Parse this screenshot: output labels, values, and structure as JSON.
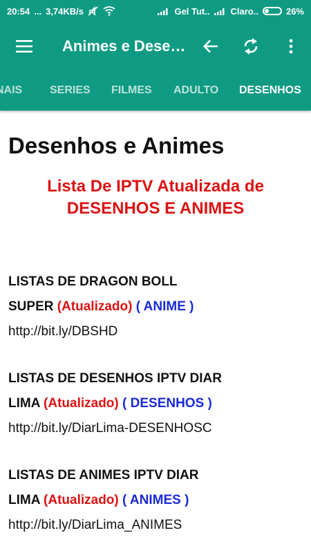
{
  "status_bar": {
    "time": "20:54",
    "dots": "...",
    "speed": "3,74KB/s",
    "carrier1": "Gel Tut..",
    "carrier2": "Claro..",
    "battery": "26%",
    "battery_level": 26
  },
  "toolbar": {
    "title": "Animes e Desenhos",
    "menu_icon": "hamburger-icon",
    "back_icon": "arrow-left-icon",
    "refresh_icon": "refresh-icon",
    "more_icon": "more-vert-icon"
  },
  "tabs": [
    {
      "label": "NAIS",
      "active": false
    },
    {
      "label": "SERIES",
      "active": false
    },
    {
      "label": "FILMES",
      "active": false
    },
    {
      "label": "ADULTO",
      "active": false
    },
    {
      "label": "DESENHOS",
      "active": true
    }
  ],
  "page": {
    "heading": "Desenhos e Animes",
    "subtitle_line1": "Lista De IPTV Atualizada de",
    "subtitle_line2": "DESENHOS E ANIMES"
  },
  "entries": [
    {
      "line1": "LISTAS DE DRAGON BOLL",
      "line2_prefix": "SUPER ",
      "status": "(Atualizado)",
      "tag_open": " ( ",
      "tag": "ANIME",
      "tag_close": " )",
      "url": "http://bit.ly/DBSHD"
    },
    {
      "line1": "LISTAS DE DESENHOS IPTV DIAR",
      "line2_prefix": "LIMA ",
      "status": "(Atualizado)",
      "tag_open": " ( ",
      "tag": "DESENHOS",
      "tag_close": " )",
      "url": "http://bit.ly/DiarLima-DESENHOSC"
    },
    {
      "line1": "LISTAS DE ANIMES IPTV DIAR",
      "line2_prefix": "LIMA ",
      "status": "(Atualizado)",
      "tag_open": " ( ",
      "tag": "ANIMES",
      "tag_close": " )",
      "url": "http://bit.ly/DiarLima_ANIMES"
    }
  ],
  "colors": {
    "primary": "#0f9b83",
    "red": "#dd1212",
    "blue": "#1a2ad6"
  }
}
